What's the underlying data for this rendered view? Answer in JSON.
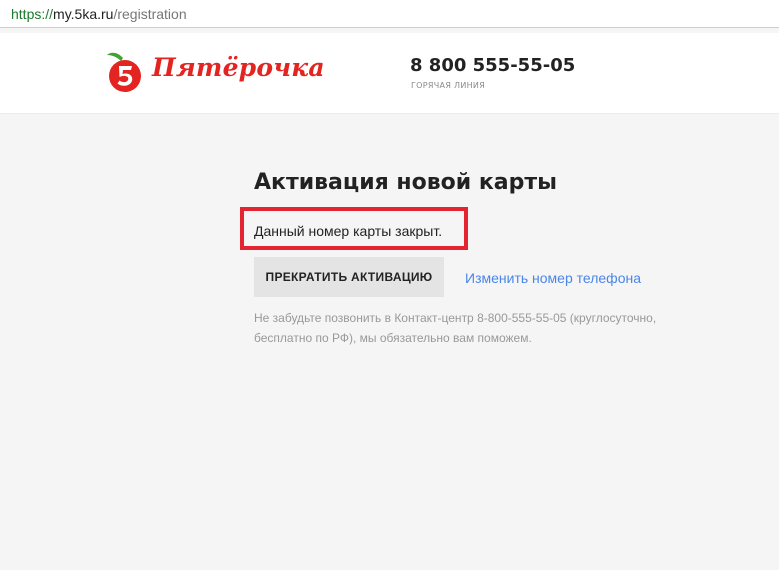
{
  "browser": {
    "url_scheme": "https://",
    "url_host": "my.5ka.ru",
    "url_path": "/registration"
  },
  "header": {
    "logo_text": "Пятёрочка",
    "phone": "8 800 555-55-05",
    "hotline_label": "ГОРЯЧАЯ ЛИНИЯ"
  },
  "main": {
    "title": "Активация новой карты",
    "message": "Данный номер карты закрыт.",
    "stop_button_label": "ПРЕКРАТИТЬ АКТИВАЦИЮ",
    "change_phone_link": "Изменить номер телефона",
    "info_text": "Не забудьте позвонить в Контакт-центр 8-800-555-55-05 (круглосуточно, бесплатно по РФ), мы обязательно вам поможем."
  },
  "icons": {
    "logo": "pyaterochka-logo-icon"
  },
  "colors": {
    "brand_red": "#e32421",
    "highlight_red": "#e32431",
    "leaf_green": "#3ea32f",
    "link_blue": "#4a86e8",
    "button_gray": "#e4e4e4",
    "page_background": "#f5f5f5"
  }
}
